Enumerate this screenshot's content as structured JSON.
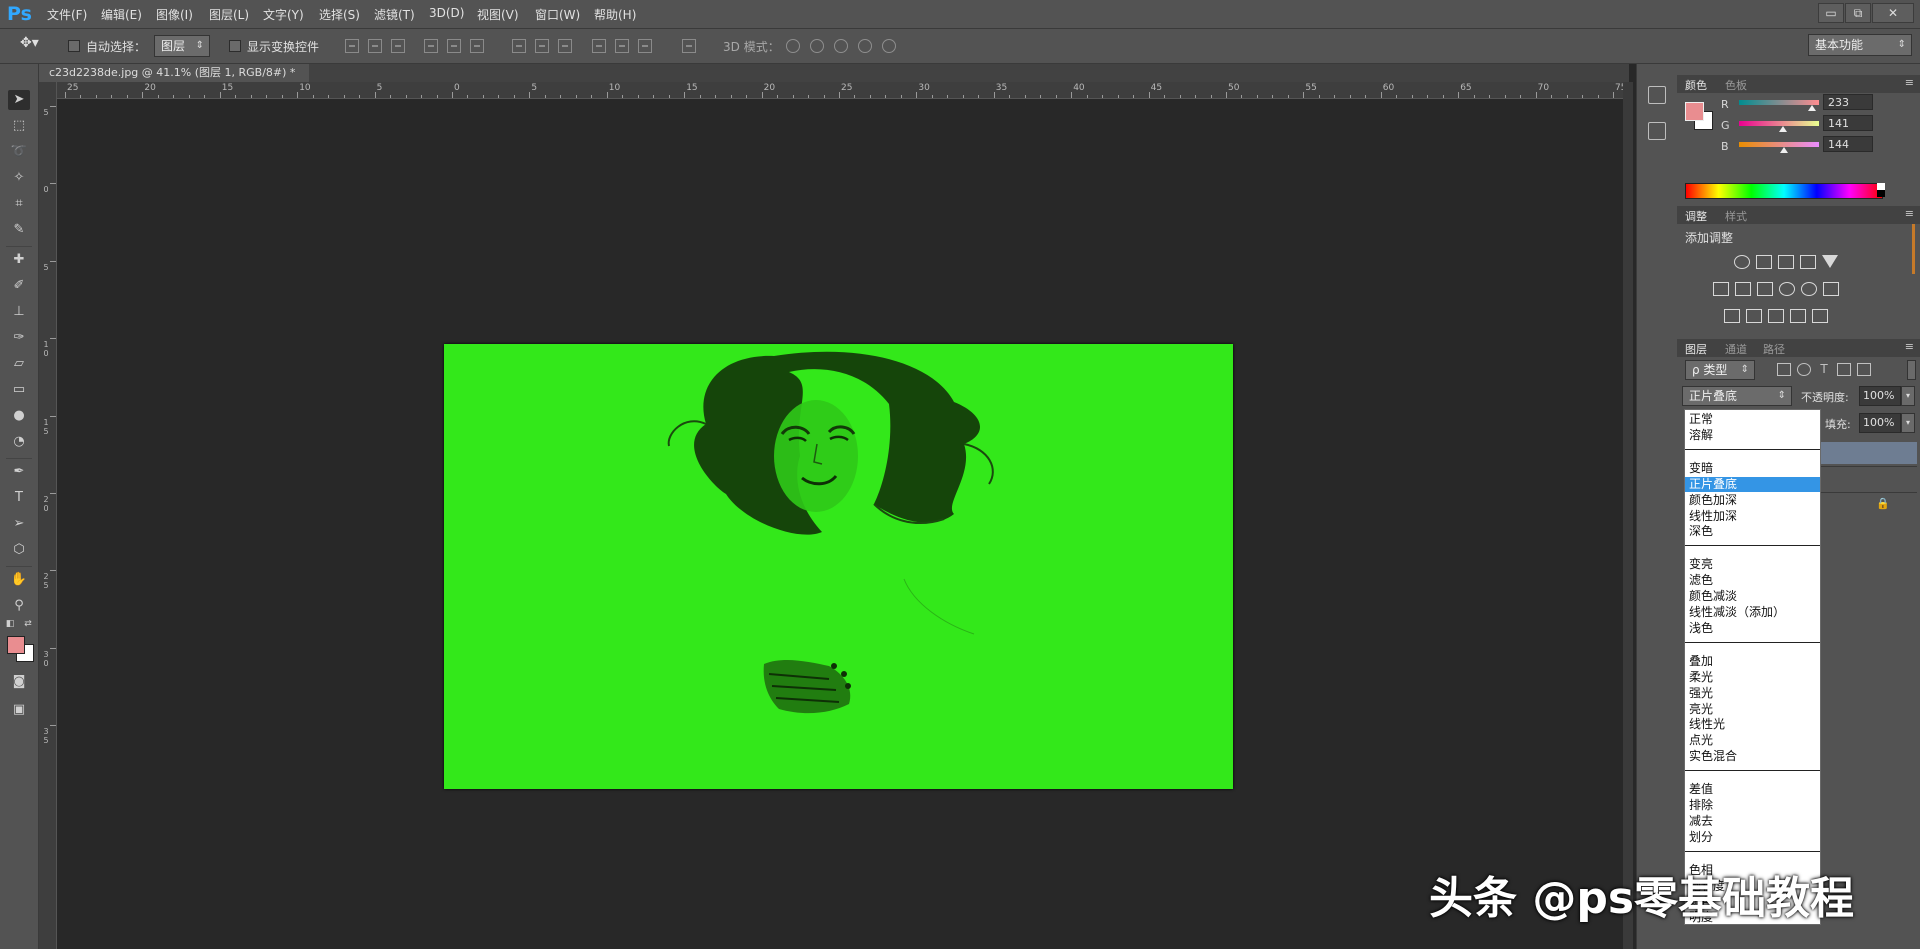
{
  "app": {
    "logo": "Ps"
  },
  "menu": [
    "文件(F)",
    "编辑(E)",
    "图像(I)",
    "图层(L)",
    "文字(Y)",
    "选择(S)",
    "滤镜(T)",
    "3D(D)",
    "视图(V)",
    "窗口(W)",
    "帮助(H)"
  ],
  "window_controls": {
    "minimize": "▭",
    "restore": "⧉",
    "close": "✕"
  },
  "options": {
    "auto_select_label": "自动选择：",
    "auto_select_target": "图层",
    "show_transform_label": "显示变换控件",
    "mode3d_label": "3D 模式：",
    "workspace": "基本功能"
  },
  "document": {
    "tab_title": "c23d2238de.jpg @ 41.1% (图层 1, RGB/8#) *",
    "tab_close": "×",
    "canvas_color": "#33e81a"
  },
  "rulers": {
    "horizontal": [
      "25",
      "20",
      "15",
      "10",
      "5",
      "0",
      "5",
      "10",
      "15",
      "20",
      "25",
      "30",
      "35",
      "40",
      "45",
      "50",
      "55",
      "60",
      "65",
      "70",
      "75"
    ],
    "vertical": [
      "5",
      "0",
      "5",
      "1 0",
      "1 5",
      "2 0",
      "2 5",
      "3 0",
      "3 5"
    ]
  },
  "color_panel": {
    "tabs": [
      "颜色",
      "色板"
    ],
    "menu": "≡",
    "foreground": "#e98d90",
    "background": "#ffffff",
    "channels": [
      {
        "label": "R",
        "value": "233",
        "fraction": 0.914,
        "gradient": "linear-gradient(to right,#008d90,#ff8d90)"
      },
      {
        "label": "G",
        "value": "141",
        "fraction": 0.553,
        "gradient": "linear-gradient(to right,#e90090,#e9ff90)"
      },
      {
        "label": "B",
        "value": "144",
        "fraction": 0.565,
        "gradient": "linear-gradient(to right,#e98d00,#e98dff)"
      }
    ]
  },
  "adjust_panel": {
    "tabs": [
      "调整",
      "样式"
    ],
    "menu": "≡",
    "heading": "添加调整"
  },
  "layers_panel": {
    "tabs": [
      "图层",
      "通道",
      "路径"
    ],
    "menu": "≡",
    "filter_label": "ρ 类型",
    "blend_mode": "正片叠底",
    "opacity_label": "不透明度:",
    "opacity_value": "100%",
    "fill_label": "填充:",
    "fill_value": "100%",
    "lock_icon": "🔒"
  },
  "blend_modes": [
    [
      "正常",
      "溶解"
    ],
    [
      "变暗",
      "正片叠底",
      "颜色加深",
      "线性加深",
      "深色"
    ],
    [
      "变亮",
      "滤色",
      "颜色减淡",
      "线性减淡（添加）",
      "浅色"
    ],
    [
      "叠加",
      "柔光",
      "强光",
      "亮光",
      "线性光",
      "点光",
      "实色混合"
    ],
    [
      "差值",
      "排除",
      "减去",
      "划分"
    ],
    [
      "色相",
      "饱和度",
      "颜色",
      "明度"
    ]
  ],
  "blend_selected": "正片叠底",
  "watermark": "头条 @ps零基础教程"
}
